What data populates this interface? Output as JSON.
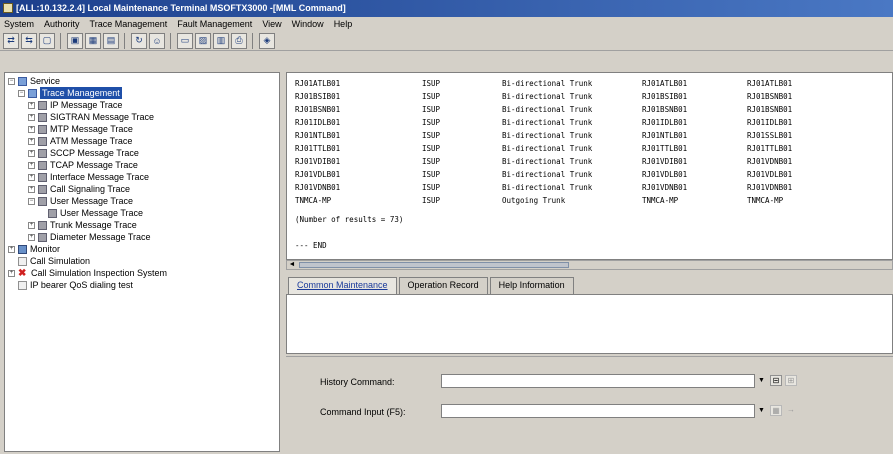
{
  "window": {
    "title": "[ALL:10.132.2.4] Local Maintenance Terminal MSOFTX3000 -[MML Command]"
  },
  "menu": [
    {
      "id": "system",
      "label": "System"
    },
    {
      "id": "authority",
      "label": "Authority"
    },
    {
      "id": "trace-management",
      "label": "Trace Management"
    },
    {
      "id": "fault-management",
      "label": "Fault Management"
    },
    {
      "id": "view",
      "label": "View"
    },
    {
      "id": "window",
      "label": "Window"
    },
    {
      "id": "help",
      "label": "Help"
    }
  ],
  "tree": {
    "items": [
      {
        "label": "Service",
        "expander": "−",
        "icon": "folder"
      },
      {
        "label": "Trace Management",
        "expander": "−",
        "icon": "folder",
        "selected": true
      },
      {
        "label": "IP Message Trace",
        "expander": "+",
        "icon": "trace"
      },
      {
        "label": "SIGTRAN Message Trace",
        "expander": "+",
        "icon": "trace"
      },
      {
        "label": "MTP Message Trace",
        "expander": "+",
        "icon": "trace"
      },
      {
        "label": "ATM Message Trace",
        "expander": "+",
        "icon": "trace"
      },
      {
        "label": "SCCP Message Trace",
        "expander": "+",
        "icon": "trace"
      },
      {
        "label": "TCAP Message Trace",
        "expander": "+",
        "icon": "trace"
      },
      {
        "label": "Interface Message Trace",
        "expander": "+",
        "icon": "trace"
      },
      {
        "label": "Call Signaling Trace",
        "expander": "+",
        "icon": "trace"
      },
      {
        "label": "User Message Trace",
        "expander": "−",
        "icon": "trace"
      },
      {
        "label": "User Message Trace",
        "expander": "",
        "icon": "trace"
      },
      {
        "label": "Trunk Message Trace",
        "expander": "+",
        "icon": "trace"
      },
      {
        "label": "Diameter Message Trace",
        "expander": "+",
        "icon": "trace"
      },
      {
        "label": "Monitor",
        "expander": "+",
        "icon": "monitor"
      },
      {
        "label": "Call Simulation",
        "expander": "",
        "icon": "call"
      },
      {
        "label": "Call Simulation Inspection System",
        "expander": "+",
        "icon": "x"
      },
      {
        "label": "IP bearer QoS dialing test",
        "expander": "",
        "icon": "call"
      }
    ]
  },
  "results": {
    "rows": [
      [
        "RJ01ATLB01",
        "ISUP",
        "Bi-directional Trunk",
        "RJ01ATLB01",
        "RJ01ATLB01"
      ],
      [
        "RJ01BSIB01",
        "ISUP",
        "Bi-directional Trunk",
        "RJ01BSIB01",
        "RJ01BSNB01"
      ],
      [
        "RJ01BSNB01",
        "ISUP",
        "Bi-directional Trunk",
        "RJ01BSNB01",
        "RJ01BSNB01"
      ],
      [
        "RJ01IDLB01",
        "ISUP",
        "Bi-directional Trunk",
        "RJ01IDLB01",
        "RJ01IDLB01"
      ],
      [
        "RJ01NTLB01",
        "ISUP",
        "Bi-directional Trunk",
        "RJ01NTLB01",
        "RJ01SSLB01"
      ],
      [
        "RJ01TTLB01",
        "ISUP",
        "Bi-directional Trunk",
        "RJ01TTLB01",
        "RJ01TTLB01"
      ],
      [
        "RJ01VDIB01",
        "ISUP",
        "Bi-directional Trunk",
        "RJ01VDIB01",
        "RJ01VDNB01"
      ],
      [
        "RJ01VDLB01",
        "ISUP",
        "Bi-directional Trunk",
        "RJ01VDLB01",
        "RJ01VDLB01"
      ],
      [
        "RJ01VDNB01",
        "ISUP",
        "Bi-directional Trunk",
        "RJ01VDNB01",
        "RJ01VDNB01"
      ],
      [
        "TNMCA-MP",
        "ISUP",
        "Outgoing Trunk",
        "TNMCA-MP",
        "TNMCA-MP"
      ]
    ],
    "summary": "(Number of results = 73)",
    "end_line": "---    END"
  },
  "tabs": [
    {
      "id": "common-maintenance",
      "label": "Common Maintenance",
      "active": true
    },
    {
      "id": "operation-record",
      "label": "Operation Record",
      "active": false
    },
    {
      "id": "help-information",
      "label": "Help Information",
      "active": false
    }
  ],
  "command": {
    "history_label": "History Command:",
    "history_value": "",
    "input_label": "Command Input (F5):",
    "input_value": ""
  },
  "icons": {
    "dropdown": "▼",
    "scroll_left": "◄"
  }
}
